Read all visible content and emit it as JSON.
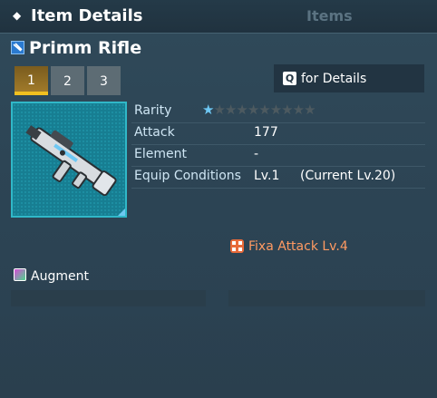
{
  "header": {
    "title": "Item Details",
    "tab_label": "Items"
  },
  "item": {
    "name": "Primm Rifle",
    "type_icon": "rifle-icon",
    "thumbnail_icon": "rifle-image"
  },
  "tabs": [
    {
      "label": "1",
      "active": true
    },
    {
      "label": "2",
      "active": false
    },
    {
      "label": "3",
      "active": false
    }
  ],
  "details_button": {
    "key": "Q",
    "label": "for Details"
  },
  "stats": {
    "rarity": {
      "label": "Rarity",
      "stars_filled": 1,
      "stars_total": 10
    },
    "attack": {
      "label": "Attack",
      "value": "177"
    },
    "element": {
      "label": "Element",
      "value": "-"
    },
    "equip": {
      "label": "Equip Conditions",
      "value": "Lv.1",
      "current": "(Current Lv.20)"
    }
  },
  "potential": {
    "label": "Fixa Attack Lv.4",
    "color": "#ff9a62"
  },
  "augment": {
    "label": "Augment"
  },
  "colors": {
    "star_filled": "#6ec8f4",
    "active_tab": "#f0c020",
    "thumb_border": "#30b8c8"
  }
}
